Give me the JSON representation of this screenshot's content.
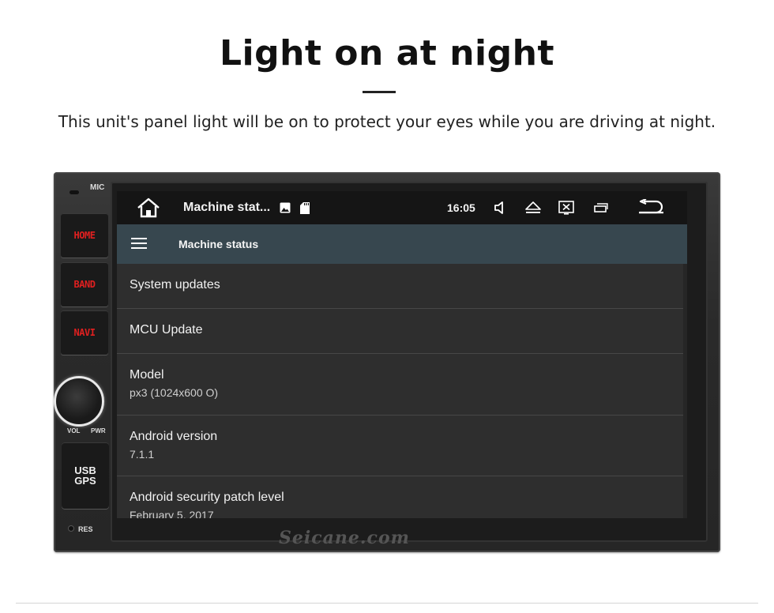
{
  "page": {
    "headline": "Light on at night",
    "subline": "This unit's panel light will be on to protect your eyes  while you are driving at night."
  },
  "unit": {
    "brand_watermark": "Seicane.com",
    "mic_label": "MIC",
    "buttons": [
      {
        "label": "HOME"
      },
      {
        "label": "BAND"
      },
      {
        "label": "NAVI"
      }
    ],
    "knob_labels": {
      "vol": "VOL",
      "pwr": "PWR"
    },
    "usb_label": "USB",
    "gps_label": "GPS",
    "res_label": "RES"
  },
  "screen": {
    "statusbar": {
      "title": "Machine stat...",
      "time": "16:05",
      "icons": [
        "home-icon",
        "image-icon",
        "sd-card-icon",
        "volume-icon",
        "eject-icon",
        "close-window-icon",
        "recent-apps-icon",
        "back-icon"
      ]
    },
    "actionbar": {
      "title": "Machine status",
      "menu_icon": "hamburger-menu-icon"
    },
    "list": [
      {
        "title": "System updates"
      },
      {
        "title": "MCU Update"
      },
      {
        "title": "Model",
        "subtitle": "px3 (1024x600 O)"
      },
      {
        "title": "Android version",
        "subtitle": "7.1.1"
      },
      {
        "title": "Android security patch level",
        "subtitle": "February 5, 2017"
      }
    ],
    "colors": {
      "statusbar": "#151515",
      "actionbar": "#37474f",
      "list_background": "#2e2e2e",
      "hardware_button_text": "#e02020"
    }
  }
}
